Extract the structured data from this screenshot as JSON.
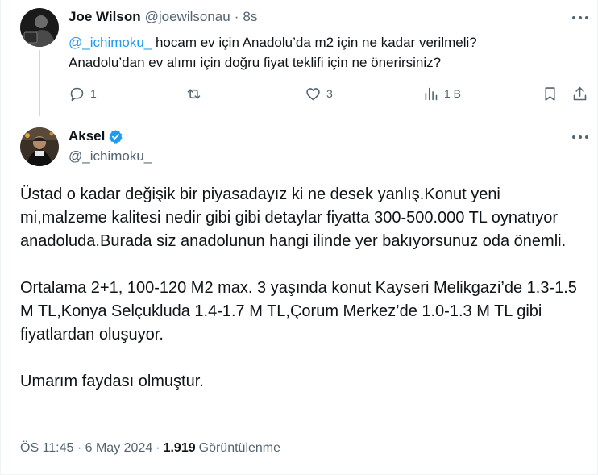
{
  "reply_tweet": {
    "author_name": "Joe Wilson",
    "author_handle": "@joewilsonau",
    "separator": "·",
    "time": "8s",
    "mention": "@_ichimoku_",
    "text_line1_rest": " hocam ev için Anadolu’da m2 için ne kadar verilmeli?",
    "text_line2": "Anadolu’dan ev alımı için doğru fiyat teklifi için ne önerirsiniz?",
    "actions": {
      "reply_count": "1",
      "retweet_count": "",
      "like_count": "3",
      "views_count": "1 B"
    }
  },
  "main_tweet": {
    "author_name": "Aksel",
    "author_handle": "@_ichimoku_",
    "verified": true,
    "paragraphs": [
      "Üstad o kadar değişik bir piyasadayız ki ne desek yanlış.Konut yeni mi,malzeme kalitesi nedir gibi gibi detaylar fiyatta 300-500.000 TL oynatıyor anadoluda.Burada siz anadolunun hangi ilinde yer bakıyorsunuz oda önemli.",
      "Ortalama 2+1, 100-120 M2 max. 3 yaşında konut Kayseri Melikgazi’de 1.3-1.5 M TL,Konya Selçukluda 1.4-1.7 M TL,Çorum Merkez’de 1.0-1.3 M TL gibi fiyatlardan oluşuyor.",
      "Umarım faydası olmuştur."
    ],
    "timestamp": "ÖS 11:45 · 6 May 2024",
    "separator": "·",
    "views_count": "1.919",
    "views_label": "Görüntülenme"
  },
  "colors": {
    "accent": "#1d9bf0",
    "muted": "#536471",
    "text": "#0f1419",
    "divider": "#eff3f4"
  }
}
